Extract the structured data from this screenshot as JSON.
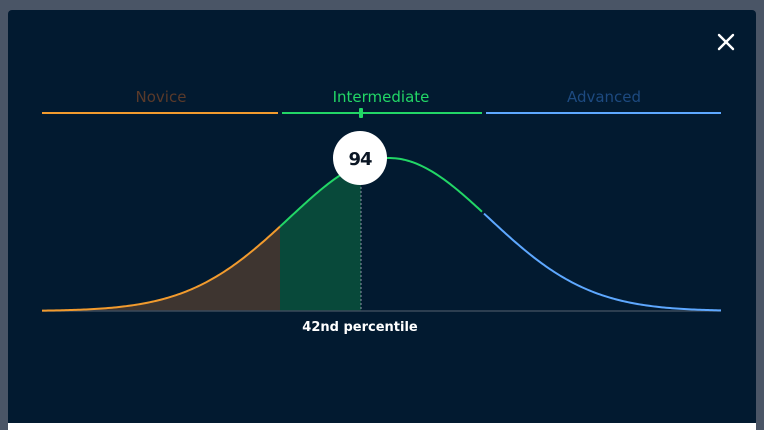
{
  "modal": {
    "close_icon": "close-icon"
  },
  "levels": [
    {
      "label": "Novice",
      "color": "#f29b2e",
      "label_color": "#5a3a2a"
    },
    {
      "label": "Intermediate",
      "color": "#22d666",
      "label_color": "#22d666"
    },
    {
      "label": "Advanced",
      "color": "#5ea8ff",
      "label_color": "#1d4a80"
    }
  ],
  "score": {
    "value": "94",
    "percentile_label": "42nd percentile"
  },
  "chart_data": {
    "type": "area",
    "distribution": "normal",
    "score_value": "94",
    "percentile": 42,
    "bands": [
      "Novice",
      "Intermediate",
      "Advanced"
    ],
    "fills": {
      "novice": "#3e3530",
      "intermediate": "#08493a"
    },
    "baseline_color": "#3a4a5a"
  }
}
